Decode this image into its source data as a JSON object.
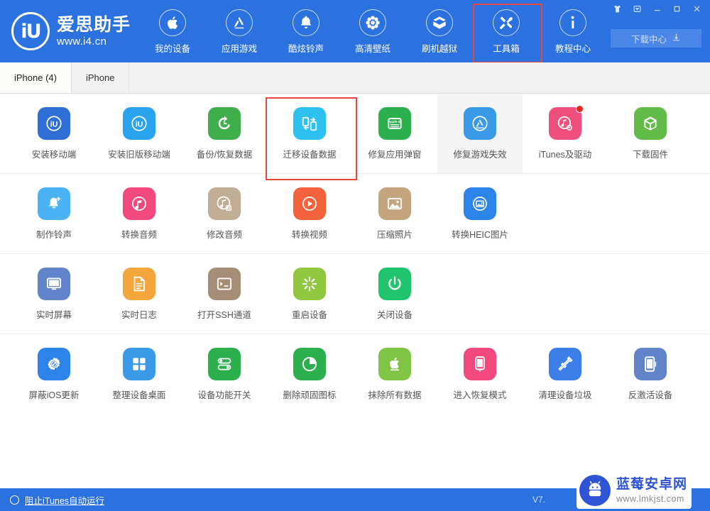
{
  "brand": {
    "logo_glyph": "iU",
    "name": "爱思助手",
    "url": "www.i4.cn"
  },
  "header": {
    "nav": [
      {
        "label": "我的设备",
        "icon": "apple-icon",
        "selected": false
      },
      {
        "label": "应用游戏",
        "icon": "appstore-icon",
        "selected": false
      },
      {
        "label": "酷炫铃声",
        "icon": "bell-icon",
        "selected": false
      },
      {
        "label": "高清壁纸",
        "icon": "flower-icon",
        "selected": false
      },
      {
        "label": "刷机越狱",
        "icon": "box-open-icon",
        "selected": false
      },
      {
        "label": "工具箱",
        "icon": "tools-icon",
        "selected": true
      },
      {
        "label": "教程中心",
        "icon": "info-icon",
        "selected": false
      }
    ],
    "window_buttons": [
      {
        "name": "skin-icon",
        "glyph": "shirt"
      },
      {
        "name": "menu-down-icon",
        "glyph": "dropdown"
      },
      {
        "name": "minimize-icon",
        "glyph": "minimize"
      },
      {
        "name": "maximize-icon",
        "glyph": "maximize"
      },
      {
        "name": "close-icon",
        "glyph": "close"
      }
    ],
    "download_center": {
      "label": "下载中心",
      "icon": "download-icon"
    },
    "accent_highlight": "#e8453c",
    "background": "#2b72e0"
  },
  "tabs": [
    {
      "label": "iPhone (4)",
      "active": true
    },
    {
      "label": "iPhone",
      "active": false
    }
  ],
  "toolbox": {
    "rows": [
      [
        {
          "label": "安装移动端",
          "icon": "i4-blue-icon",
          "color": "#2e6fd6",
          "hover": false,
          "outlined": false,
          "badge": false
        },
        {
          "label": "安装旧版移动端",
          "icon": "i4-lightblue-icon",
          "color": "#2aa3ef",
          "hover": false,
          "outlined": false,
          "badge": false
        },
        {
          "label": "备份/恢复数据",
          "icon": "restore-icon",
          "color": "#3fae4b",
          "hover": false,
          "outlined": false,
          "badge": false
        },
        {
          "label": "迁移设备数据",
          "icon": "transfer-icon",
          "color": "#2ec1ef",
          "hover": false,
          "outlined": true,
          "badge": false
        },
        {
          "label": "修复应用弹窗",
          "icon": "appleid-card-icon",
          "color": "#2cb04e",
          "hover": false,
          "outlined": false,
          "badge": false
        },
        {
          "label": "修复游戏失效",
          "icon": "appstore-check-icon",
          "color": "#3a9ae8",
          "hover": true,
          "outlined": false,
          "badge": false
        },
        {
          "label": "iTunes及驱动",
          "icon": "itunes-gear-icon",
          "color": "#ef4f7c",
          "hover": false,
          "outlined": false,
          "badge": true
        },
        {
          "label": "下载固件",
          "icon": "cube-icon",
          "color": "#62bb46",
          "hover": false,
          "outlined": false,
          "badge": false
        }
      ],
      [
        {
          "label": "制作铃声",
          "icon": "bell-plus-icon",
          "color": "#4ab3f4",
          "hover": false,
          "outlined": false,
          "badge": false
        },
        {
          "label": "转换音频",
          "icon": "music-note-icon",
          "color": "#f1497e",
          "hover": false,
          "outlined": false,
          "badge": false
        },
        {
          "label": "修改音频",
          "icon": "music-edit-icon",
          "color": "#c2ae94",
          "hover": false,
          "outlined": false,
          "badge": false
        },
        {
          "label": "转换视频",
          "icon": "play-icon",
          "color": "#f4623c",
          "hover": false,
          "outlined": false,
          "badge": false
        },
        {
          "label": "压缩照片",
          "icon": "photo-icon",
          "color": "#c5a57e",
          "hover": false,
          "outlined": false,
          "badge": false
        },
        {
          "label": "转换HEIC图片",
          "icon": "photo-convert-icon",
          "color": "#2d84e8",
          "hover": false,
          "outlined": false,
          "badge": false
        }
      ],
      [
        {
          "label": "实时屏幕",
          "icon": "monitor-icon",
          "color": "#6183c9",
          "hover": false,
          "outlined": false,
          "badge": false
        },
        {
          "label": "实时日志",
          "icon": "document-icon",
          "color": "#f4a63c",
          "hover": false,
          "outlined": false,
          "badge": false
        },
        {
          "label": "打开SSH通道",
          "icon": "terminal-icon",
          "color": "#a58d76",
          "hover": false,
          "outlined": false,
          "badge": false
        },
        {
          "label": "重启设备",
          "icon": "restart-icon",
          "color": "#90c73e",
          "hover": false,
          "outlined": false,
          "badge": false
        },
        {
          "label": "关闭设备",
          "icon": "power-icon",
          "color": "#1fc46c",
          "hover": false,
          "outlined": false,
          "badge": false
        }
      ],
      [
        {
          "label": "屏蔽iOS更新",
          "icon": "gear-block-icon",
          "color": "#2d84e8",
          "hover": false,
          "outlined": false,
          "badge": false
        },
        {
          "label": "整理设备桌面",
          "icon": "grid-apps-icon",
          "color": "#3a9ae8",
          "hover": false,
          "outlined": false,
          "badge": false
        },
        {
          "label": "设备功能开关",
          "icon": "toggles-icon",
          "color": "#2cb04e",
          "hover": false,
          "outlined": false,
          "badge": false
        },
        {
          "label": "删除顽固图标",
          "icon": "pie-clock-icon",
          "color": "#2cb04e",
          "hover": false,
          "outlined": false,
          "badge": false
        },
        {
          "label": "抹除所有数据",
          "icon": "apple-erase-icon",
          "color": "#7fc444",
          "hover": false,
          "outlined": false,
          "badge": false
        },
        {
          "label": "进入恢复模式",
          "icon": "phone-plug-icon",
          "color": "#f1497e",
          "hover": false,
          "outlined": false,
          "badge": false
        },
        {
          "label": "清理设备垃圾",
          "icon": "broom-icon",
          "color": "#3d7fe8",
          "hover": false,
          "outlined": false,
          "badge": false
        },
        {
          "label": "反激活设备",
          "icon": "phone-block-icon",
          "color": "#6183c9",
          "hover": false,
          "outlined": false,
          "badge": false
        }
      ]
    ]
  },
  "statusbar": {
    "auto_itunes_label": "阻止iTunes自动运行",
    "auto_itunes_checked": false,
    "version": "V7."
  },
  "watermark": {
    "title": "蓝莓安卓网",
    "url": "www.lmkjst.com",
    "icon": "android-robot-icon",
    "color": "#2f54d6"
  }
}
